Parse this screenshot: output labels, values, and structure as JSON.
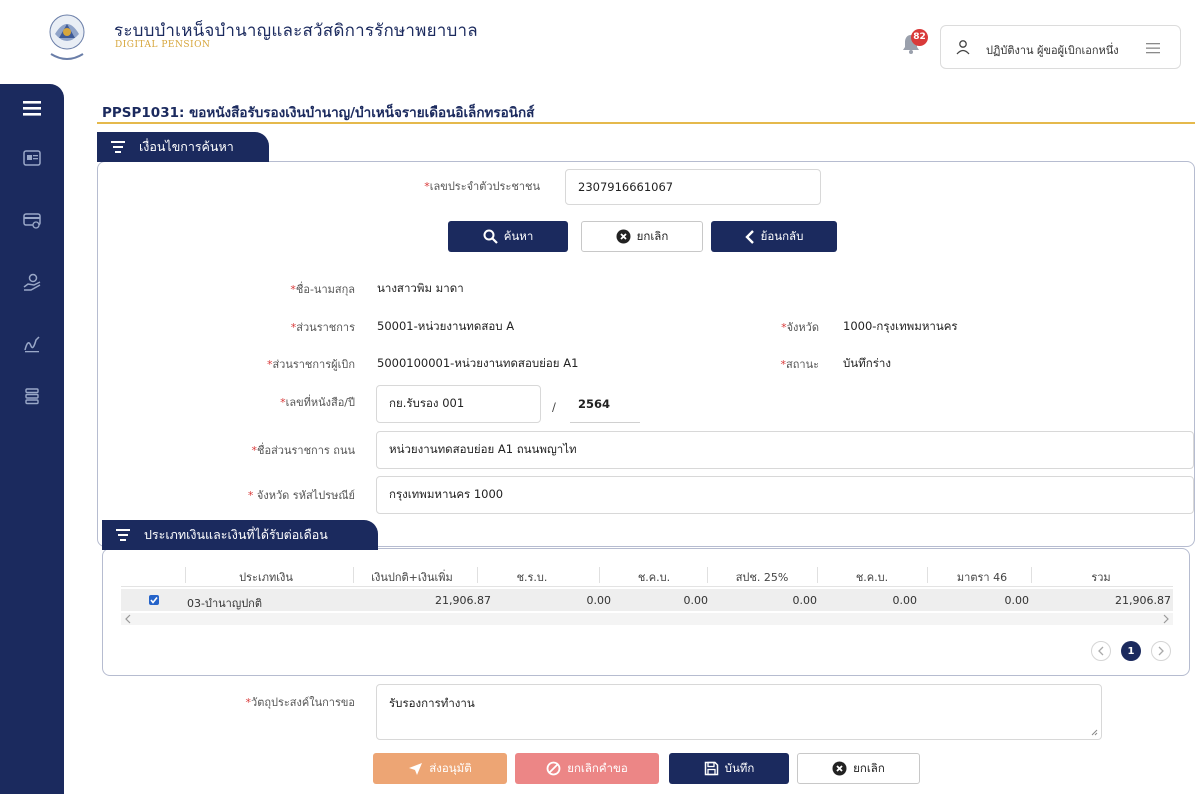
{
  "header": {
    "app_title": "ระบบบำเหน็จบำนาญและสวัสดิการรักษาพยาบาล",
    "app_subtitle": "DIGITAL PENSION",
    "notification_count": "82",
    "user_name": "ปฏิบัติงาน ผู้ขอผู้เบิกเอกหนึ่ง"
  },
  "sidebar": {
    "items": [
      "menu-icon",
      "id-card-icon",
      "payment-icon",
      "hand-money-icon",
      "signature-icon",
      "list-icon"
    ]
  },
  "page": {
    "title": "PPSP1031: ขอหนังสือรับรองเงินบำนาญ/บำเหน็จรายเดือนอิเล็กทรอนิกส์"
  },
  "search_section": {
    "tab_label": "เงื่อนไขการค้นหา",
    "citizen_id_label": "เลขประจำตัวประชาชน",
    "citizen_id_value": "2307916661067",
    "search_button": "ค้นหา",
    "cancel_button": "ยกเลิก",
    "back_button": "ย้อนกลับ",
    "fullname_label": "ชื่อ-นามสกุล",
    "fullname_value": "นางสาวพิม มาดา",
    "agency_label": "ส่วนราชการ",
    "agency_value": "50001-หน่วยงานทดสอบ A",
    "province_label": "จังหวัด",
    "province_value": "1000-กรุงเทพมหานคร",
    "paying_agency_label": "ส่วนราชการผู้เบิก",
    "paying_agency_value": "5000100001-หน่วยงานทดสอบย่อย A1",
    "status_label": "สถานะ",
    "status_value": "บันทึกร่าง",
    "doc_no_label": "เลขที่หนังสือ/ปี",
    "doc_no_value": "กย.รับรอง 001",
    "doc_separator": "/",
    "doc_year_value": "2564",
    "agency_road_label": "ชื่อส่วนราชการ ถนน",
    "agency_road_value": "หน่วยงานทดสอบย่อย A1 ถนนพญาไท",
    "province_zip_label": "จังหวัด รหัสไปรษณีย์",
    "province_zip_value": "กรุงเทพมหานคร 1000"
  },
  "payment_section": {
    "tab_label": "ประเภทเงินและเงินที่ได้รับต่อเดือน",
    "columns": [
      "ประเภทเงิน",
      "เงินปกติ+เงินเพิ่ม",
      "ช.ร.บ.",
      "ช.ค.บ.",
      "สปช. 25%",
      "ช.ค.บ.",
      "มาตรา 46",
      "รวม"
    ],
    "rows": [
      {
        "type": "03-บำนาญปกติ",
        "values": [
          "21,906.87",
          "0.00",
          "0.00",
          "0.00",
          "0.00",
          "0.00",
          "21,906.87"
        ],
        "checked": true
      }
    ],
    "current_page": "1"
  },
  "purpose": {
    "label": "วัตถุประสงค์ในการขอ",
    "value": "รับรองการทำงาน"
  },
  "actions": {
    "submit": "ส่งอนุมัติ",
    "cancel_request": "ยกเลิกคำขอ",
    "save": "บันทึก",
    "cancel": "ยกเลิก"
  },
  "colors": {
    "navy": "#1b2a5e",
    "gold": "#e5b94c",
    "orange": "#eda574",
    "red": "#ec8686",
    "badge": "#d93a3a"
  }
}
